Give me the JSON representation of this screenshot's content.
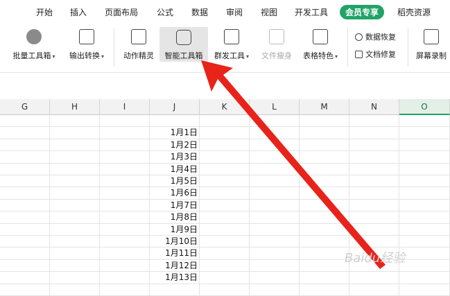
{
  "tabs": [
    {
      "label": "开始"
    },
    {
      "label": "插入"
    },
    {
      "label": "页面布局"
    },
    {
      "label": "公式"
    },
    {
      "label": "数据"
    },
    {
      "label": "审阅"
    },
    {
      "label": "视图"
    },
    {
      "label": "开发工具"
    },
    {
      "label": "会员专享"
    },
    {
      "label": "稻壳资源"
    }
  ],
  "ribbon": {
    "batch_toolbox": "批量工具箱",
    "export_convert": "输出转换",
    "action_wizard": "动作精灵",
    "smart_toolbox": "智能工具箱",
    "group_send": "群发工具",
    "file_slim": "文件瘦身",
    "table_features": "表格特色",
    "data_recovery": "数据恢复",
    "file_repair": "文档修复",
    "screen_record": "屏幕录制"
  },
  "columns": [
    "G",
    "H",
    "I",
    "J",
    "K",
    "L",
    "M",
    "N",
    "O"
  ],
  "dates": [
    "1月1日",
    "1月2日",
    "1月3日",
    "1月4日",
    "1月5日",
    "1月6日",
    "1月7日",
    "1月8日",
    "1月9日",
    "1月10日",
    "1月11日",
    "1月12日",
    "1月13日"
  ],
  "watermark": "Baidu经验",
  "colors": {
    "accent": "#21a366",
    "arrow": "#e8231a"
  }
}
